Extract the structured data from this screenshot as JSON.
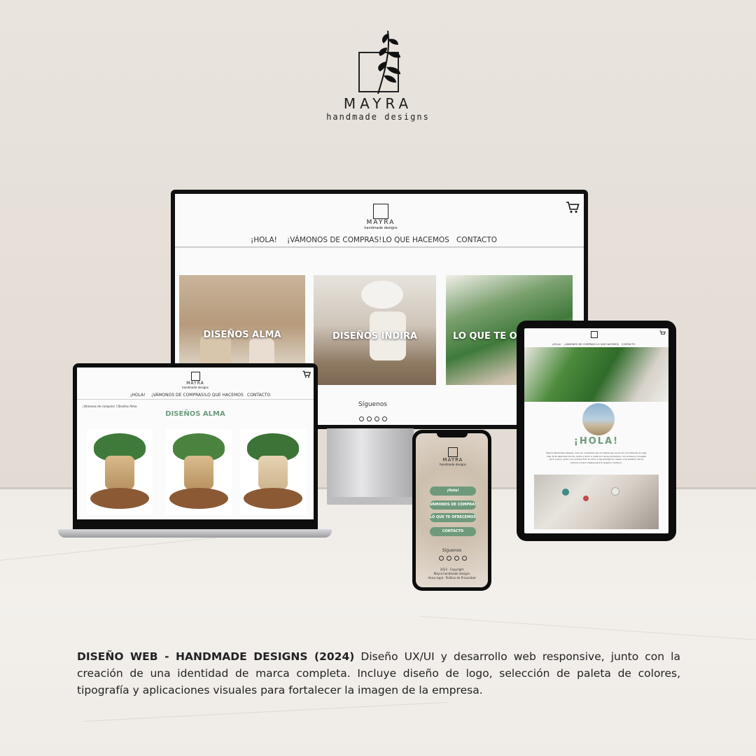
{
  "brand": {
    "name": "MAYRA",
    "tagline": "handmade designs"
  },
  "desktop": {
    "logo_name": "MAYRA",
    "logo_tagline": "handmade designs",
    "nav": [
      "¡HOLA!",
      "¡VÁMONOS DE COMPRAS!",
      "LO QUE HACEMOS",
      "CONTACTO"
    ],
    "cards": [
      "DISEÑOS ALMA",
      "DISEÑOS INDIRA",
      "LO QUE TE OFRECEMOS"
    ],
    "follow": "Síguenos",
    "icons": [
      "whatsapp-icon",
      "facebook-icon",
      "instagram-icon",
      "tiktok-icon"
    ]
  },
  "laptop": {
    "logo_name": "MAYRA",
    "logo_tagline": "handmade designs",
    "nav": [
      "¡HOLA!",
      "¡VÁMONOS DE COMPRAS!",
      "LO QUE HACEMOS",
      "CONTACTO"
    ],
    "breadcrumb": "¡Vámonos de compras! / Diseños Alma",
    "title": "DISEÑOS ALMA"
  },
  "phone": {
    "logo_name": "MAYRA",
    "logo_tagline": "handmade designs",
    "buttons": [
      "¡Hola!",
      "VÁMONOS DE COMPRAS",
      "LO QUE TE OFRECEMOS",
      "CONTACTO"
    ],
    "follow": "Síguenos",
    "footer": [
      "2023 · Copyright",
      "Mayra handmade designs",
      "Aviso legal · Política de Privacidad"
    ]
  },
  "tablet": {
    "nav": [
      "¡HOLA!",
      "¡VÁMONOS DE COMPRAS!",
      "LO QUE HACEMOS",
      "CONTACTO"
    ],
    "heading": "¡HOLA!",
    "body": "Mayra handmade designs, nace en noviembre de un hobbie que se ha ido convirtiendo en algo más, fe te dedicado mucho cariño y amor a cada uno de los productos, con la idea si completo poco a poco, junto a la construcción en amor a las plantas he creado unos diseños únicos hechos a mano ideales para tu espacio moderno."
  },
  "caption": {
    "title": "DISEÑO WEB - HANDMADE DESIGNS (2024)",
    "text": "Diseño UX/UI y desarrollo web responsive, junto con la creación de una identidad de marca completa. Incluye diseño de logo, selección de paleta de colores, tipografía y aplicaciones visuales para fortalecer la imagen de la empresa."
  },
  "colors": {
    "accent_green": "#6e9a7b",
    "ink": "#1e1e1e",
    "wall": "#e5dfd8"
  }
}
